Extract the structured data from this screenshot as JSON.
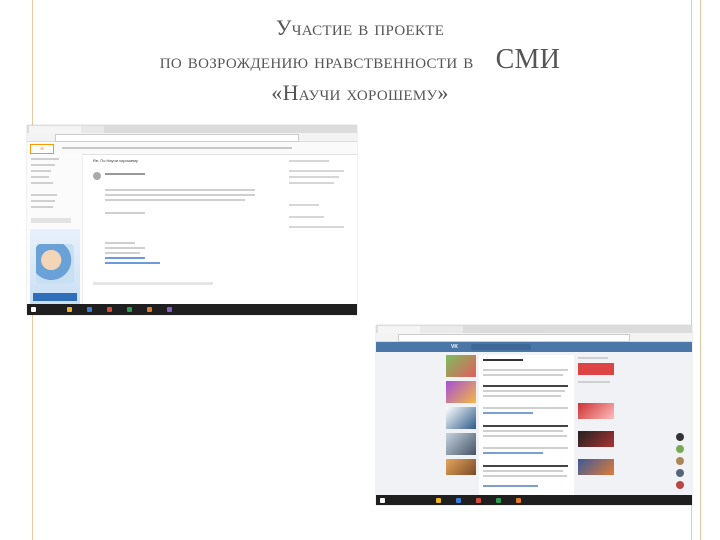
{
  "slide": {
    "title_line1": "Участие в проекте",
    "title_line2": "по возрождению нравственности в",
    "title_tail": "СМИ",
    "title_line3": "«Научи хорошему»"
  },
  "mail_screenshot": {
    "brand_color": "#ff6d00",
    "subject": "Re: По Научи хорошему",
    "icons": [
      "mail-icon",
      "avatar-icon",
      "taskbar-icons"
    ]
  },
  "vk_screenshot": {
    "header_color": "#4a76a8",
    "logo": "VK",
    "icons": [
      "vk-logo-icon",
      "chat-bubble-icons",
      "taskbar-icons"
    ]
  }
}
